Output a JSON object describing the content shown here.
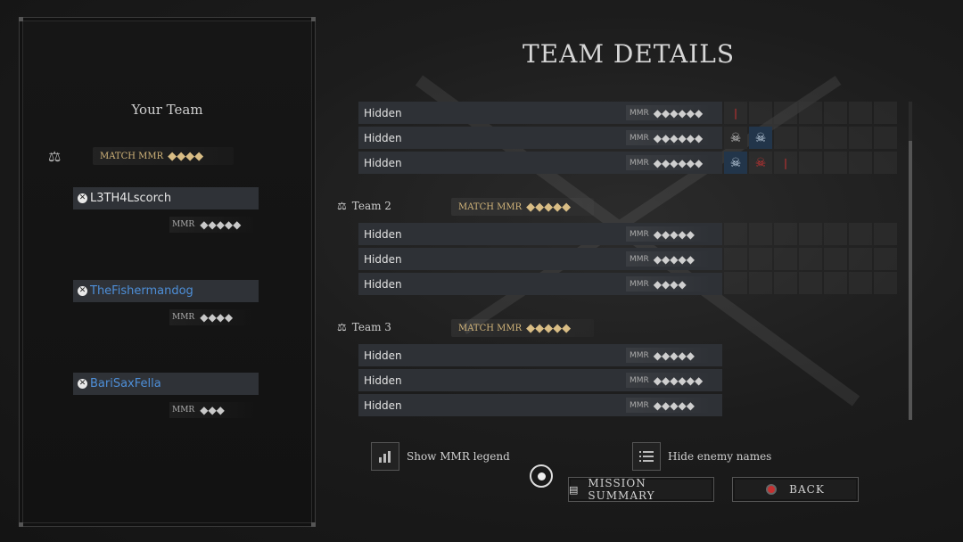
{
  "page_title": "TEAM DETAILS",
  "your_team": {
    "title": "Your Team",
    "match_mmr_label": "MATCH MMR",
    "match_mmr_stars": "◆◆◆◆",
    "players": [
      {
        "name": "L3TH4Lscorch",
        "name_color": "#e6e6e6",
        "mmr_label": "MMR",
        "stars": "◆◆◆◆◆"
      },
      {
        "name": "TheFishermandog",
        "name_color": "#4e8fd8",
        "mmr_label": "MMR",
        "stars": "◆◆◆◆"
      },
      {
        "name": "BariSaxFella",
        "name_color": "#4e8fd8",
        "mmr_label": "MMR",
        "stars": "◆◆◆"
      }
    ]
  },
  "teams": [
    {
      "name": "",
      "rows": [
        {
          "name": "Hidden",
          "mmr_label": "MMR",
          "stars": "◆◆◆◆◆◆"
        },
        {
          "name": "Hidden",
          "mmr_label": "MMR",
          "stars": "◆◆◆◆◆◆"
        },
        {
          "name": "Hidden",
          "mmr_label": "MMR",
          "stars": "◆◆◆◆◆◆"
        }
      ]
    },
    {
      "name": "Team 2",
      "match_mmr_label": "MATCH MMR",
      "match_mmr_stars": "◆◆◆◆◆",
      "rows": [
        {
          "name": "Hidden",
          "mmr_label": "MMR",
          "stars": "◆◆◆◆◆"
        },
        {
          "name": "Hidden",
          "mmr_label": "MMR",
          "stars": "◆◆◆◆◆"
        },
        {
          "name": "Hidden",
          "mmr_label": "MMR",
          "stars": "◆◆◆◆"
        }
      ]
    },
    {
      "name": "Team 3",
      "match_mmr_label": "MATCH MMR",
      "match_mmr_stars": "◆◆◆◆◆",
      "rows": [
        {
          "name": "Hidden",
          "mmr_label": "MMR",
          "stars": "◆◆◆◆◆"
        },
        {
          "name": "Hidden",
          "mmr_label": "MMR",
          "stars": "◆◆◆◆◆◆"
        },
        {
          "name": "Hidden",
          "mmr_label": "MMR",
          "stars": "◆◆◆◆◆"
        }
      ]
    }
  ],
  "controls": {
    "show_mmr_legend": "Show MMR legend",
    "hide_enemy_names": "Hide enemy names",
    "mission_summary": "MISSION SUMMARY",
    "back": "BACK"
  },
  "icons": {
    "balance": "scale-icon",
    "xbox": "xbox-icon",
    "skull": "skull-icon"
  },
  "colors": {
    "gold": "#d9bd85",
    "blue_name": "#4e8fd8",
    "kill_red": "#c33333"
  }
}
